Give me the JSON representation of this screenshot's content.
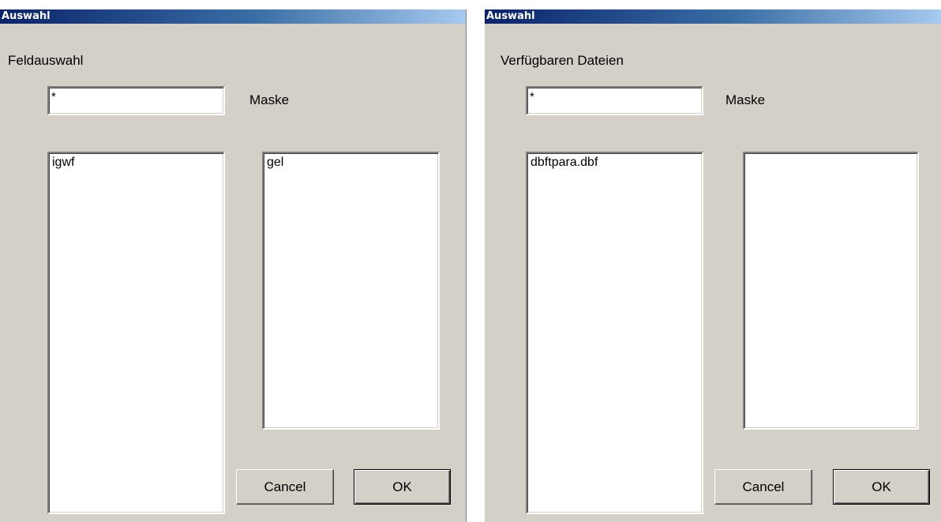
{
  "dialogs": [
    {
      "title": "Auswahl",
      "section_label": "Feldauswahl",
      "mask_value": "*",
      "mask_label": "Maske",
      "left_list": [
        "igwf"
      ],
      "right_list": [
        "gel"
      ],
      "cancel_label": "Cancel",
      "ok_label": "OK"
    },
    {
      "title": "Auswahl",
      "section_label": "Verfügbaren Dateien",
      "mask_value": "*",
      "mask_label": "Maske",
      "left_list": [
        "dbftpara.dbf"
      ],
      "right_list": [],
      "cancel_label": "Cancel",
      "ok_label": "OK"
    }
  ],
  "colors": {
    "face": "#d4d0c8",
    "title_start": "#0a246a",
    "title_end": "#a6caf0"
  }
}
